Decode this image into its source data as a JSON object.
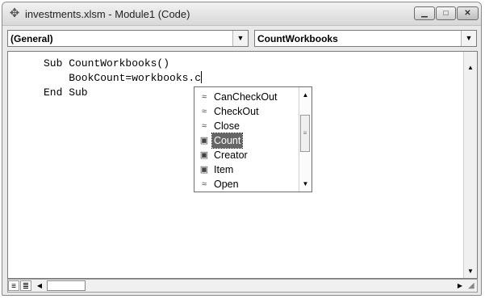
{
  "window": {
    "title": "investments.xlsm - Module1 (Code)",
    "icon": "vba-module-icon",
    "minimize_glyph": "▁",
    "maximize_glyph": "□",
    "close_glyph": "✕"
  },
  "object_combo": {
    "value": "(General)",
    "arrow": "▼"
  },
  "procedure_combo": {
    "value": "CountWorkbooks",
    "arrow": "▼"
  },
  "code": {
    "line1": "Sub CountWorkbooks()",
    "line2": "    BookCount=workbooks.c",
    "line3": "End Sub"
  },
  "autocomplete": {
    "items": [
      {
        "label": "CanCheckOut",
        "icon": "method-icon",
        "glyph": "≈"
      },
      {
        "label": "CheckOut",
        "icon": "method-icon",
        "glyph": "≈"
      },
      {
        "label": "Close",
        "icon": "method-icon",
        "glyph": "≈"
      },
      {
        "label": "Count",
        "icon": "property-icon",
        "glyph": "▣",
        "selected": true
      },
      {
        "label": "Creator",
        "icon": "property-icon",
        "glyph": "▣"
      },
      {
        "label": "Item",
        "icon": "property-icon",
        "glyph": "▣"
      },
      {
        "label": "Open",
        "icon": "method-icon",
        "glyph": "≈"
      }
    ]
  },
  "scroll": {
    "up": "▲",
    "down": "▼",
    "left": "◀",
    "right": "▶"
  },
  "view": {
    "procedure_view": "≡",
    "module_view": "≣"
  },
  "colors": {
    "selection": "#666666",
    "window_bg": "#e9e9e9"
  }
}
